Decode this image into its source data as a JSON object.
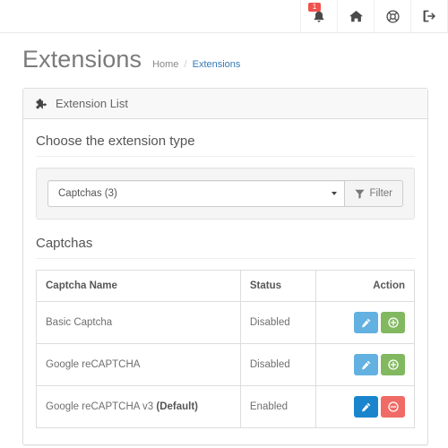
{
  "header": {
    "icons": [
      {
        "name": "notifications-bell-icon",
        "label": "Notifications",
        "badge": "1"
      },
      {
        "name": "home-icon",
        "label": "Storefront"
      },
      {
        "name": "support-lifebuoy-icon",
        "label": "Support"
      },
      {
        "name": "logout-icon",
        "label": "Logout"
      }
    ]
  },
  "page": {
    "title": "Extensions",
    "breadcrumb": {
      "home": "Home",
      "separator": "/",
      "current": "Extensions"
    }
  },
  "panel": {
    "heading_icon": "puzzle-piece-icon",
    "heading": "Extension List",
    "section_title": "Choose the extension type",
    "filter": {
      "selected_option": "Captchas (3)",
      "button_label": "Filter",
      "button_icon": "filter-funnel-icon"
    },
    "list_title": "Captchas",
    "table": {
      "columns": [
        "Captcha Name",
        "Status",
        "Action"
      ],
      "rows": [
        {
          "name": "Basic Captcha",
          "name_suffix": "",
          "status": "Disabled",
          "actions": [
            {
              "icon": "pencil-edit-icon",
              "style": "edit-light"
            },
            {
              "icon": "plus-circle-icon",
              "style": "plus"
            }
          ]
        },
        {
          "name": "Google reCAPTCHA",
          "name_suffix": "",
          "status": "Disabled",
          "actions": [
            {
              "icon": "pencil-edit-icon",
              "style": "edit-light"
            },
            {
              "icon": "plus-circle-icon",
              "style": "plus"
            }
          ]
        },
        {
          "name": "Google reCAPTCHA v3 ",
          "name_suffix": "(Default)",
          "status": "Enabled",
          "actions": [
            {
              "icon": "pencil-edit-icon",
              "style": "edit-dark"
            },
            {
              "icon": "minus-circle-icon",
              "style": "minus"
            }
          ]
        }
      ]
    }
  },
  "colors": {
    "link": "#337ab7",
    "badge": "#f0524d",
    "edit_light": "#62b1e0",
    "edit_dark": "#1a85cd",
    "install_green": "#82b860",
    "uninstall_red": "#f06b66",
    "panel_border": "#dddddd",
    "well_bg": "#f5f5f5"
  }
}
